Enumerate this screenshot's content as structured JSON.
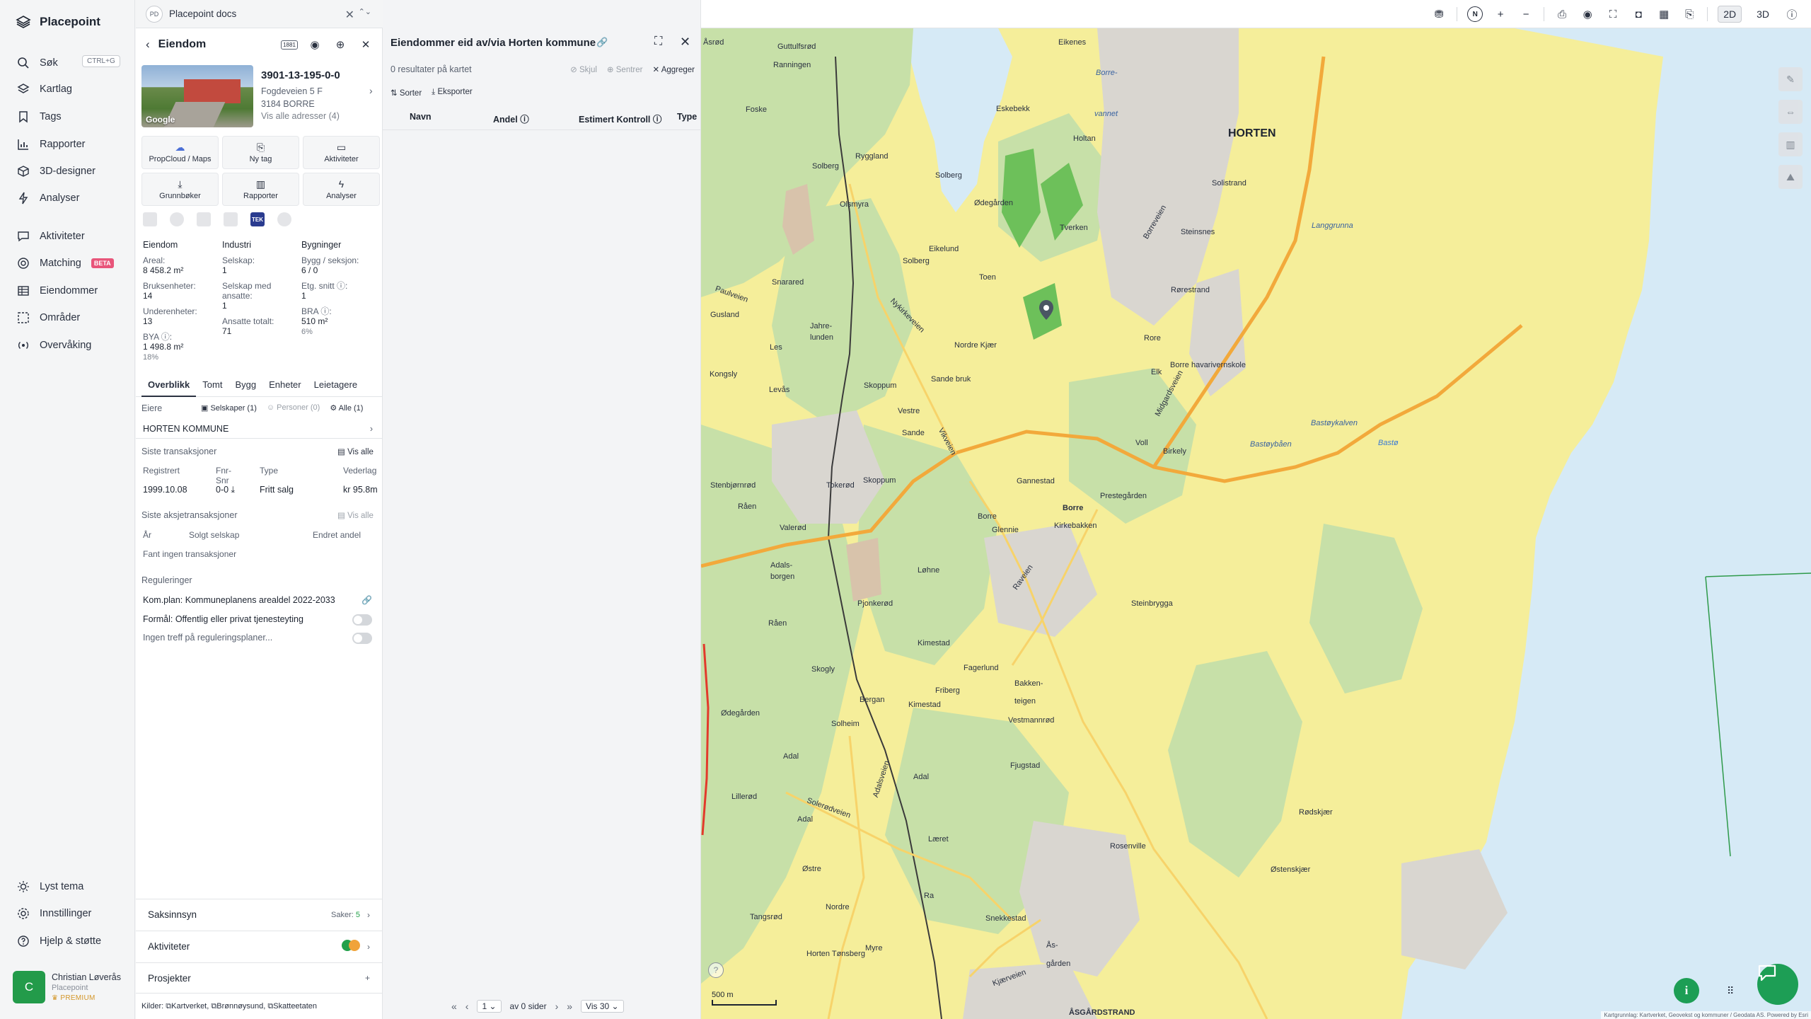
{
  "nav": {
    "brand": "Placepoint",
    "search_shortcut": "CTRL+G",
    "items": [
      {
        "label": "Søk",
        "icon": "search-icon"
      },
      {
        "label": "Kartlag",
        "icon": "layers-icon"
      },
      {
        "label": "Tags",
        "icon": "bookmark-icon"
      },
      {
        "label": "Rapporter",
        "icon": "chart-icon"
      },
      {
        "label": "3D-designer",
        "icon": "cube-icon"
      },
      {
        "label": "Analyser",
        "icon": "lightning-icon"
      },
      {
        "label": "Aktiviteter",
        "icon": "chat-icon"
      },
      {
        "label": "Matching",
        "icon": "target-icon",
        "badge": "BETA"
      },
      {
        "label": "Eiendommer",
        "icon": "grid-icon"
      },
      {
        "label": "Områder",
        "icon": "area-icon"
      },
      {
        "label": "Overvåking",
        "icon": "broadcast-icon"
      }
    ],
    "bottom": [
      {
        "label": "Lyst tema",
        "icon": "sun-icon"
      },
      {
        "label": "Innstillinger",
        "icon": "gear-icon"
      },
      {
        "label": "Hjelp & støtte",
        "icon": "help-icon"
      }
    ],
    "user": {
      "initial": "C",
      "name": "Christian Løverås",
      "org": "Placepoint",
      "plan": "PREMIUM"
    }
  },
  "tab": {
    "badge": "PD",
    "title": "Placepoint docs"
  },
  "property": {
    "header": "Eiendom",
    "header_badge": "1881",
    "photo_brand": "Google",
    "id": "3901-13-195-0-0",
    "street": "Fogdeveien 5 F",
    "postal": "3184 BORRE",
    "all_addresses": "Vis alle adresser (4)",
    "actions": [
      {
        "label": "PropCloud / Maps",
        "icon": "cloud-icon"
      },
      {
        "label": "Ny tag",
        "icon": "bookmark-icon"
      },
      {
        "label": "Aktiviteter",
        "icon": "chat-icon"
      },
      {
        "label": "Grunnbøker",
        "icon": "download-icon"
      },
      {
        "label": "Rapporter",
        "icon": "chart-icon"
      },
      {
        "label": "Analyser",
        "icon": "lightning-icon"
      }
    ],
    "source_tek": "TEK",
    "stats": {
      "col1_header": "Eiendom",
      "col2_header": "Industri",
      "col3_header": "Bygninger",
      "areal_label": "Areal:",
      "areal_value": "8 458.2 m²",
      "bruksenheter_label": "Bruksenheter:",
      "bruksenheter_value": "14",
      "underenheter_label": "Underenheter:",
      "underenheter_value": "13",
      "bya_label": "BYA ⓘ:",
      "bya_value": "1 498.8 m²",
      "bya_pct": "18%",
      "selskap_label": "Selskap:",
      "selskap_value": "1",
      "selskap_ansatte_label": "Selskap med ansatte:",
      "selskap_ansatte_value": "1",
      "ansatte_label": "Ansatte totalt:",
      "ansatte_value": "71",
      "bygg_label": "Bygg / seksjon:",
      "bygg_value": "6 / 0",
      "etg_label": "Etg. snitt ⓘ:",
      "etg_value": "1",
      "bra_label": "BRA ⓘ:",
      "bra_value": "510 m²",
      "bra_pct": "6%"
    },
    "subtabs": [
      "Overblikk",
      "Tomt",
      "Bygg",
      "Enheter",
      "Leietagere"
    ],
    "owners": {
      "label": "Eiere",
      "filters": [
        "Selskaper (1)",
        "Personer (0)",
        "Alle (1)"
      ],
      "name": "HORTEN KOMMUNE"
    },
    "transactions": {
      "label": "Siste transaksjoner",
      "show_all": "Vis alle",
      "headers": [
        "Registrert",
        "Fnr-Snr",
        "Type",
        "Vederlag"
      ],
      "row": [
        "1999.10.08",
        "0-0",
        "Fritt salg",
        "kr 95.8m"
      ]
    },
    "share_tx": {
      "label": "Siste aksjetransaksjoner",
      "show_all": "Vis alle",
      "headers": [
        "År",
        "Solgt selskap",
        "Endret andel"
      ],
      "empty": "Fant ingen transaksjoner"
    },
    "regulations": {
      "label": "Reguleringer",
      "plan": "Kom.plan: Kommuneplanens arealdel 2022-2033",
      "purpose": "Formål: Offentlig eller privat tjenesteyting",
      "none": "Ingen treff på reguleringsplaner..."
    },
    "accordions": {
      "saksinnsyn": "Saksinnsyn",
      "saker_label": "Saker:",
      "saker_value": "5",
      "aktiviteter": "Aktiviteter",
      "prosjekter": "Prosjekter"
    },
    "sources_label": "Kilder:",
    "sources": [
      "Kartverket",
      "Brønnøysund",
      "Skatteetaten"
    ]
  },
  "results": {
    "title": "Eiendommer eid av/via Horten kommune",
    "count": "0 resultater på kartet",
    "actions": [
      "Skjul",
      "Sentrer",
      "Aggreger"
    ],
    "tools": [
      "Sorter",
      "Eksporter"
    ],
    "columns": [
      "Navn",
      "Andel ⓘ",
      "Estimert Kontroll ⓘ",
      "Type"
    ],
    "pager": {
      "page": "1",
      "of": "av 0 sider",
      "per_page": "Vis 30"
    }
  },
  "map": {
    "modes": [
      "2D",
      "3D"
    ],
    "active_mode": "2D",
    "north": "N",
    "scale": "500 m",
    "attribution": "Kartgrunnlag: Kartverket, Geovekst og kommuner / Geodata AS. Powered by Esri",
    "labels": {
      "horten": "HORTEN",
      "borre_vannet_1": "Borre-",
      "borre_vannet_2": "vannet",
      "asgardstrand": "ÅSGÅRDSTRAND",
      "gullsjord": "Guttulfsrød",
      "eikenes": "Eikenes",
      "asrod": "Åsrød",
      "ranningen": "Ranningen",
      "foske": "Foske",
      "ryggland": "Ryggland",
      "solberg1": "Solberg",
      "olsmyra": "Olsmyra",
      "eskebekk": "Eskebekk",
      "holtan": "Holtan",
      "tverken": "Tverken",
      "solberg2": "Solberg",
      "odegarden1": "Ødegården",
      "eikelund": "Eikelund",
      "toen": "Toen",
      "solberg3": "Solberg",
      "borre": "Borre",
      "paulveien": "Paulveien",
      "snarared": "Snarared",
      "gusland": "Gusland",
      "jahre": "Jahre-",
      "lunden": "lunden",
      "les": "Les",
      "kongsly": "Kongsly",
      "levas": "Levås",
      "skoppum": "Skoppum",
      "sande_bruk": "Sande bruk",
      "nordre_kjaer": "Nordre Kjær",
      "vestre": "Vestre",
      "sande": "Sande",
      "rore": "Rore",
      "elk": "Elk",
      "voll": "Voll",
      "borre_hav": "Borre havarivernskole",
      "solistrand": "Solistrand",
      "steinsnes": "Steinsnes",
      "langgrunna": "Langgrunna",
      "rarestrand": "Rørestrand",
      "bastoybaen": "Bastøybåen",
      "bastoykalven": "Bastøykalven",
      "bast": "Bastø",
      "birkely": "Birkely",
      "gannestad": "Gannestad",
      "prestegarden": "Prestegården",
      "kirkebakken": "Kirkebakken",
      "borre_vil": "Borre",
      "glennie": "Glennie",
      "steinbrygga": "Steinbrygga",
      "stenbjornrod": "Stenbjørnrød",
      "raen": "Råen",
      "vallerod": "Valerød",
      "tokerod": "Tokerød",
      "skoppum2": "Skoppum",
      "lohne": "Løhne",
      "adalsborgen": "Adals-",
      "adalsborgen2": "borgen",
      "pjonkerod": "Pjonkerød",
      "kimestad": "Kimestad",
      "fagerlund": "Fagerlund",
      "raen2": "Råen",
      "skogly": "Skogly",
      "bergan": "Bergan",
      "kimestad2": "Kimestad",
      "friberg": "Friberg",
      "bakken": "Bakken-",
      "teigen": "teigen",
      "vestmannrød": "Vestmannrød",
      "solheim": "Solheim",
      "odegarden2": "Ødegården",
      "fjugstad": "Fjugstad",
      "adal": "Adal",
      "adal2": "Adal",
      "adal3": "Adal",
      "lillerod": "Lillerød",
      "laret": "Læret",
      "rosenville": "Rosenville",
      "ostre": "Østre",
      "ra": "Ra",
      "nordre": "Nordre",
      "snekkestad": "Snekkestad",
      "tangsrod": "Tangsrød",
      "myre": "Myre",
      "horten_tonsberg": "Horten Tønsberg",
      "asgarden": "Ås-",
      "asgarden2": "gården",
      "rodskjaer": "Rødskjær",
      "ostenskjaer": "Østenskjær",
      "bredstrand": "Bredstrand",
      "solerodveien": "Solerødveien",
      "adalsveien": "Adalsveien",
      "raveien": "Raveien",
      "borreveien": "Borreveien",
      "midgardsveien": "Midgardsveien",
      "nykirkeveien": "Nykirkeveien",
      "vikveien": "Vikveien",
      "kjaerveien": "Kjærveien",
      "mapmarker_label": "Borre"
    }
  },
  "colors": {
    "accent": "#1d9e55",
    "map_farmland": "#f5ee9a",
    "map_forest": "#c7e0a8",
    "map_water": "#d6eaf6",
    "map_road": "#f2a93b"
  }
}
